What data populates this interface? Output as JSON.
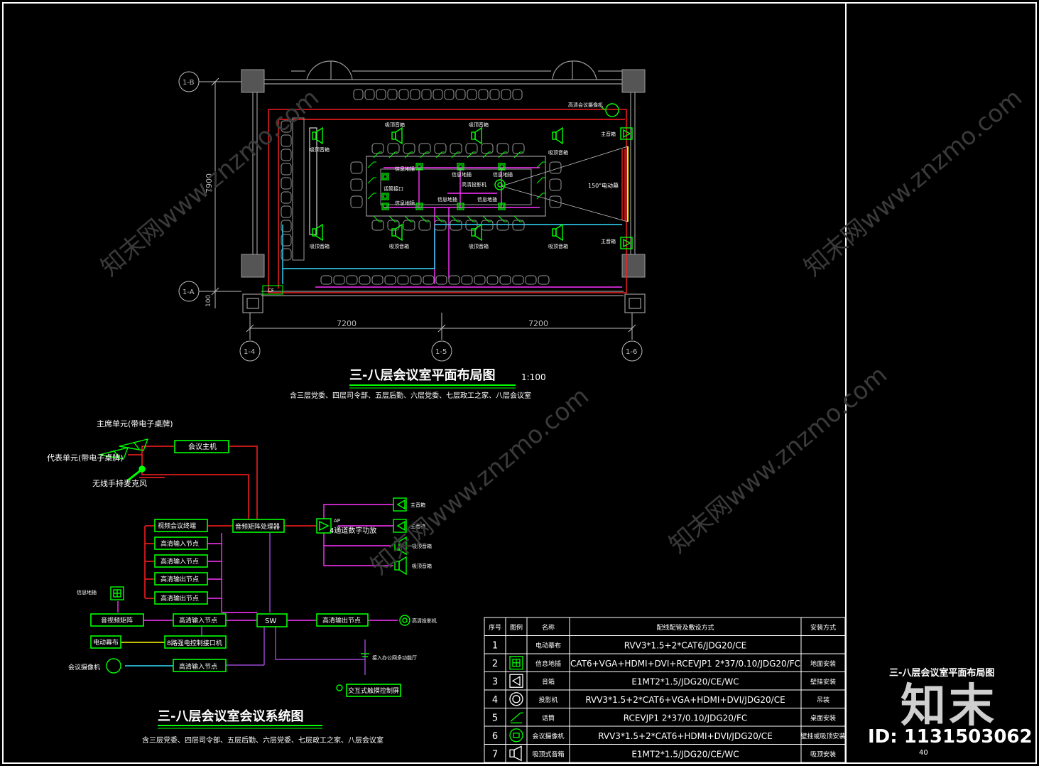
{
  "plan": {
    "title": "三-八层会议室平面布局图",
    "scale": "1:100",
    "subtitle": "含三层党委、四层司令部、五层后勤、六层党委、七层政工之家、八层会议室",
    "axis_labels": [
      "1-B",
      "1-A",
      "1-4",
      "1-5",
      "1-6"
    ],
    "dimensions": {
      "height": "7900",
      "small": "100",
      "span_left": "7200",
      "span_right": "7200"
    },
    "labels": {
      "hd_camera": "高清会议摄像机",
      "main_speaker_top": "主音箱",
      "main_speaker_bottom": "主音箱",
      "ceiling_speaker": "吸顶音箱",
      "info_floor_box": "信息地插",
      "hd_projector": "高清投影机",
      "mic_interface": "话筒接口",
      "screen": "150\"电动幕",
      "cf": "CF"
    }
  },
  "system": {
    "title": "三-八层会议室会议系统图",
    "subtitle": "含三层党委、四层司令部、五层后勤、六层党委、七层政工之家、八层会议室",
    "chairman_unit": "主席单元(带电子桌牌)",
    "delegate_unit": "代表单元(带电子桌牌)",
    "wireless_mic": "无线手持麦克风",
    "conference_host": "会议主机",
    "audio_matrix": "音频矩阵处理器",
    "video_terminal": "视频会议终端",
    "hd_input_1": "高清输入节点",
    "hd_input_2": "高清输入节点",
    "hd_output_1": "高清输出节点",
    "hd_output_2": "高清输出节点",
    "info_box": "信息地插",
    "av_matrix": "音视频矩阵",
    "hd_input_3": "高清输入节点",
    "sw": "SW",
    "hd_output_3": "高清输出节点",
    "projector": "高清投影机",
    "power_screen": "电动幕布",
    "relay_host": "8路强电控制接口机",
    "camera": "会议摄像机",
    "hd_input_4": "高清输入节点",
    "amp": "4通道数字功放",
    "amp_tag": "AP",
    "main_spk_1": "主音箱",
    "main_spk_2": "主音箱",
    "ceil_spk_1": "吸顶音箱",
    "ceil_spk_2": "吸顶音箱",
    "network_note": "接入办公网多功能厅",
    "touch_panel": "交互式触摸控制屏"
  },
  "legend_table": {
    "headers": [
      "序号",
      "图例",
      "名称",
      "配线配管及敷设方式",
      "安装方式"
    ],
    "rows": [
      {
        "no": "1",
        "icon": "screen-icon",
        "name": "电动幕布",
        "wiring": "RVV3*1.5+2*CAT6/JDG20/CE",
        "install": ""
      },
      {
        "no": "2",
        "icon": "floor-box-icon",
        "name": "信息地插",
        "wiring": "CAT6+VGA+HDMI+DVI+RCEVJP1 2*37/0.10/JDG20/FC",
        "install": "地面安装"
      },
      {
        "no": "3",
        "icon": "speaker-icon",
        "name": "音箱",
        "wiring": "E1MT2*1.5/JDG20/CE/WC",
        "install": "壁挂安装"
      },
      {
        "no": "4",
        "icon": "projector-icon",
        "name": "投影机",
        "wiring": "RVV3*1.5+2*CAT6+VGA+HDMI+DVI/JDG20/CE",
        "install": "吊装"
      },
      {
        "no": "5",
        "icon": "microphone-icon",
        "name": "话筒",
        "wiring": "RCEVJP1 2*37/0.10/JDG20/FC",
        "install": "桌面安装"
      },
      {
        "no": "6",
        "icon": "camera-icon",
        "name": "会议摄像机",
        "wiring": "RVV3*1.5+2*CAT6+HDMI+DVI/JDG20/CE",
        "install": "壁挂或吸顶安装"
      },
      {
        "no": "7",
        "icon": "ceiling-speaker-icon",
        "name": "吸顶式音箱",
        "wiring": "E1MT2*1.5/JDG20/CE/WC",
        "install": "吸顶安装"
      }
    ]
  },
  "title_block": {
    "drawing_title": "三-八层会议室平面布局图",
    "brand": "知末",
    "id_text": "ID: 1131503062",
    "page_no": "40"
  },
  "watermark": "知末网www.znzmo.com",
  "colors": {
    "frame": "#ffffff",
    "green": "#00ff00",
    "red": "#ff2020",
    "magenta": "#ff33ff",
    "cyan": "#33ddff",
    "yellow": "#ffff00",
    "grey": "#9a9a9a",
    "dark_grey": "#555555"
  }
}
